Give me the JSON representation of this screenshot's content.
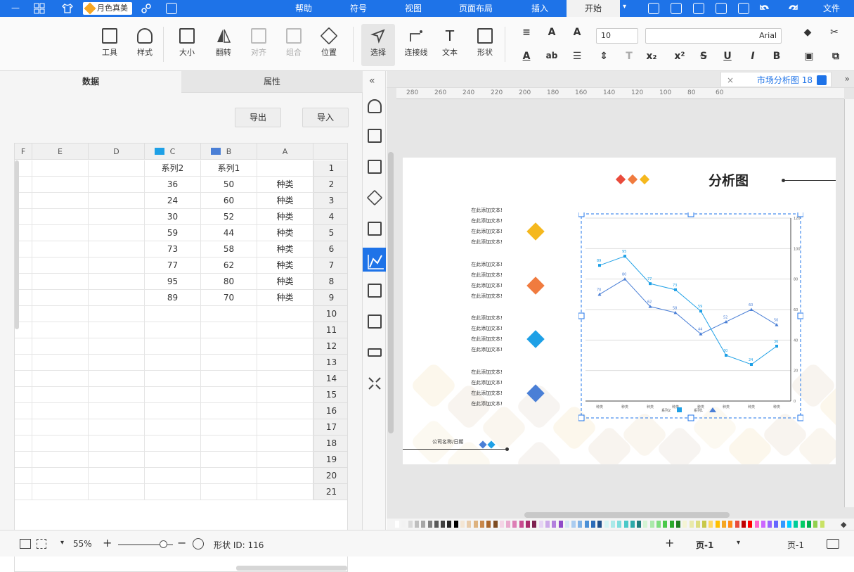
{
  "menubar": {
    "tabs": [
      "文件",
      "开始",
      "插入",
      "页面布局",
      "视图",
      "符号",
      "帮助"
    ],
    "active_tab": "开始",
    "brand": "月色真美"
  },
  "ribbon": {
    "tools": [
      "工具",
      "样式",
      "大小",
      "翻转",
      "对齐",
      "组合",
      "位置",
      "选择",
      "连接线",
      "文本",
      "形状"
    ],
    "font_name": "Arial",
    "font_size": "10"
  },
  "panel": {
    "tabs": [
      "数据",
      "属性"
    ],
    "active_tab": "数据",
    "import_label": "导入",
    "export_label": "导出",
    "columns": [
      "A",
      "B",
      "C",
      "D",
      "E",
      "F"
    ],
    "series_headers": [
      "系列1",
      "系列2"
    ],
    "rows": [
      {
        "n": "1",
        "a": "",
        "b": "系列1",
        "c": "系列2"
      },
      {
        "n": "2",
        "a": "种类",
        "b": "50",
        "c": "36"
      },
      {
        "n": "3",
        "a": "种类",
        "b": "60",
        "c": "24"
      },
      {
        "n": "4",
        "a": "种类",
        "b": "52",
        "c": "30"
      },
      {
        "n": "5",
        "a": "种类",
        "b": "44",
        "c": "59"
      },
      {
        "n": "6",
        "a": "种类",
        "b": "58",
        "c": "73"
      },
      {
        "n": "7",
        "a": "种类",
        "b": "62",
        "c": "77"
      },
      {
        "n": "8",
        "a": "种类",
        "b": "80",
        "c": "95"
      },
      {
        "n": "9",
        "a": "种类",
        "b": "70",
        "c": "89"
      },
      {
        "n": "10",
        "a": "",
        "b": "",
        "c": ""
      },
      {
        "n": "11",
        "a": "",
        "b": "",
        "c": ""
      },
      {
        "n": "12",
        "a": "",
        "b": "",
        "c": ""
      },
      {
        "n": "13",
        "a": "",
        "b": "",
        "c": ""
      },
      {
        "n": "14",
        "a": "",
        "b": "",
        "c": ""
      },
      {
        "n": "15",
        "a": "",
        "b": "",
        "c": ""
      },
      {
        "n": "16",
        "a": "",
        "b": "",
        "c": ""
      },
      {
        "n": "17",
        "a": "",
        "b": "",
        "c": ""
      },
      {
        "n": "18",
        "a": "",
        "b": "",
        "c": ""
      },
      {
        "n": "19",
        "a": "",
        "b": "",
        "c": ""
      },
      {
        "n": "20",
        "a": "",
        "b": "",
        "c": ""
      },
      {
        "n": "21",
        "a": "",
        "b": "",
        "c": ""
      }
    ],
    "series_colors": {
      "b": "#4a7fd6",
      "c": "#1ea0e6"
    }
  },
  "document": {
    "tab_title": "市场分析图 18",
    "title": "分析图",
    "company_label": "公司名称/日期",
    "text_blocks": [
      [
        "在此添加文本!",
        "在此添加文本!",
        "在此添加文本!",
        "在此添加文本!"
      ],
      [
        "在此添加文本!",
        "在此添加文本!",
        "在此添加文本!",
        "在此添加文本!"
      ],
      [
        "在此添加文本!",
        "在此添加文本!",
        "在此添加文本!",
        "在此添加文本!"
      ],
      [
        "在此添加文本!",
        "在此添加文本!",
        "在此添加文本!",
        "在此添加文本!"
      ]
    ],
    "diamond_colors": [
      "#f5b81e",
      "#f07b3f",
      "#1ea0e6",
      "#4a7fd6"
    ],
    "title_diamond_colors": [
      "#e94b3c",
      "#f07b3f",
      "#f5b81e"
    ],
    "ruler_ticks": [
      "280",
      "260",
      "240",
      "220",
      "200",
      "180",
      "160",
      "140",
      "120",
      "100",
      "80",
      "60"
    ]
  },
  "chart_data": {
    "type": "line",
    "categories": [
      "种类",
      "种类",
      "种类",
      "种类",
      "种类",
      "种类",
      "种类",
      "种类"
    ],
    "series": [
      {
        "name": "系列1",
        "values": [
          50,
          60,
          52,
          44,
          58,
          62,
          80,
          70
        ]
      },
      {
        "name": "系列2",
        "values": [
          36,
          24,
          30,
          59,
          73,
          77,
          95,
          89
        ]
      }
    ],
    "ylim": [
      0,
      120
    ],
    "grid": true,
    "legend": "bottom"
  },
  "status": {
    "page_label": "页-1",
    "page_tab": "页-1",
    "shape_id": "形状 ID: 116",
    "zoom": "55%"
  },
  "palette": [
    "#ffffff",
    "#f2f2f2",
    "#d9d9d9",
    "#bfbfbf",
    "#a6a6a6",
    "#808080",
    "#595959",
    "#404040",
    "#262626",
    "#000000",
    "#f4e6d4",
    "#e9ccaa",
    "#ddb27f",
    "#c8874a",
    "#a9652b",
    "#7d4b20",
    "#f4d4e6",
    "#e9aace",
    "#dd7fb5",
    "#c84a8f",
    "#a92b6b",
    "#7d204f",
    "#e6d4f4",
    "#ccaae9",
    "#b27fdd",
    "#8f4ac8",
    "#d4e6f4",
    "#aaccf0",
    "#7fb2e6",
    "#4a8fd6",
    "#2b6bb9",
    "#204f8a",
    "#d4f4f4",
    "#aae9e9",
    "#7fdddd",
    "#4ac8c8",
    "#2ba9a9",
    "#207d7d",
    "#d4f4d4",
    "#aae9aa",
    "#7fdd7f",
    "#4ac84a",
    "#2ba92b",
    "#207d20",
    "#f4f4d4",
    "#e9e9aa",
    "#dddd7f",
    "#c8c84a",
    "#ffd966",
    "#ffc000",
    "#f5a623",
    "#ff8c1a",
    "#e94b3c",
    "#c00000",
    "#ff0000",
    "#ff66cc",
    "#cc66ff",
    "#9966ff",
    "#6666ff",
    "#3399ff",
    "#00ccff",
    "#00cc99",
    "#00cc66",
    "#00b050",
    "#92d050",
    "#c9e265"
  ]
}
